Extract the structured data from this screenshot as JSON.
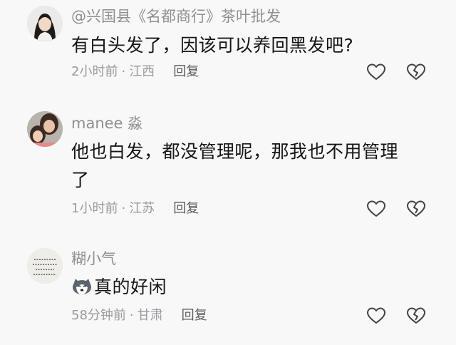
{
  "comments": [
    {
      "username": "@兴国县《名都商行》茶叶批发",
      "text": "有白头发了，因该可以养回黑发吧?",
      "time": "2小时前",
      "location": "江西",
      "separator": "·",
      "reply_label": "回复",
      "avatar_icon": "woman-portrait-avatar"
    },
    {
      "username": "manee 淼",
      "text": "他也白发，都没管理呢，那我也不用管理了",
      "time": "1小时前",
      "location": "江苏",
      "separator": "·",
      "reply_label": "回复",
      "avatar_icon": "mother-child-avatar"
    },
    {
      "username": "糊小气",
      "text": "真的好闲",
      "time": "58分钟前",
      "location": "甘肃",
      "separator": "·",
      "reply_label": "回复",
      "avatar_icon": "handwritten-note-avatar",
      "emoji_icon": "husky-dog-emoji"
    }
  ],
  "colors": {
    "background": "#f8f8f8",
    "text": "#151515",
    "username": "#8f8f94",
    "meta": "#9a9aa0",
    "reply": "#5a5a60"
  },
  "icons": {
    "like": "heart-outline-icon",
    "dislike": "broken-heart-outline-icon"
  }
}
